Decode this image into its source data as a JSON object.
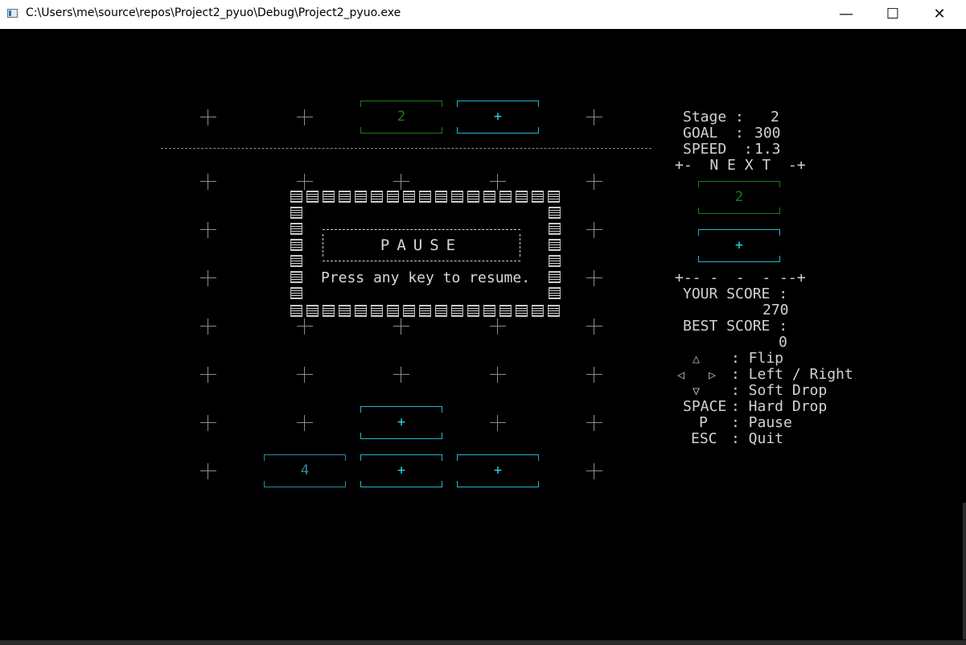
{
  "window": {
    "title": "C:\\Users\\me\\source\\repos\\Project2_pyuo\\Debug\\Project2_pyuo.exe",
    "minimize": "—",
    "maximize": "☐",
    "close": "✕"
  },
  "board": {
    "cells": [
      "2",
      "+",
      "+",
      "4",
      "+",
      "+"
    ]
  },
  "pause": {
    "title": "PAUSE",
    "message": "Press any key to resume."
  },
  "hud": {
    "stage_label": "Stage :",
    "stage_value": "2",
    "goal_label": "GOAL  :",
    "goal_value": "300",
    "speed_label": "SPEED  :",
    "speed_value": "1.3",
    "next_header": "+-  N E X T  -+",
    "next_cells": [
      "2",
      "+"
    ],
    "next_footer": "+-- -  -  - --+",
    "your_score_label": "YOUR SCORE :",
    "your_score_value": "270",
    "best_score_label": "BEST SCORE :",
    "best_score_value": "0"
  },
  "controls": {
    "up_icon": "△",
    "left_icon": "◁",
    "right_icon": "▷",
    "down_icon": "▽",
    "flip": ": Flip",
    "left_right": ": Left / Right",
    "soft_drop": ": Soft Drop",
    "space_key": "SPACE",
    "hard_drop": ": Hard Drop",
    "p_key": "P",
    "pause": ": Pause",
    "esc_key": "ESC",
    "quit": ": Quit"
  },
  "colors": {
    "background": "#000000",
    "green_block": "#1b7d1b",
    "cyan_block": "#20b8c6",
    "text": "#d2d2d2"
  }
}
